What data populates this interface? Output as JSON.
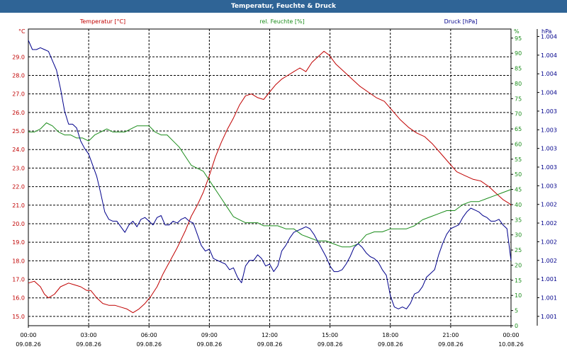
{
  "title": "Temperatur, Feuchte & Druck",
  "colors": {
    "temperature": "#c00000",
    "humidity": "#1a8c1a",
    "pressure": "#00008b",
    "titlebar": "#2f6496",
    "grid": "#000000"
  },
  "chart_data": {
    "type": "line",
    "title": "Temperatur, Feuchte & Druck",
    "x_tick_labels": [
      [
        "00:00",
        "09.08.26"
      ],
      [
        "03:00",
        "09.08.26"
      ],
      [
        "06:00",
        "09.08.26"
      ],
      [
        "09:00",
        "09.08.26"
      ],
      [
        "12:00",
        "09.08.26"
      ],
      [
        "15:00",
        "09.08.26"
      ],
      [
        "18:00",
        "09.08.26"
      ],
      [
        "21:00",
        "09.08.26"
      ],
      [
        "00:00",
        "10.08.26"
      ]
    ],
    "x_range_hours": [
      0,
      24
    ],
    "grid": true,
    "axes": {
      "temperature": {
        "label": "Temperatur [°C]",
        "unit": "°C",
        "side": "left",
        "ticks": [
          "15.0",
          "16.0",
          "17.0",
          "18.0",
          "19.0",
          "20.0",
          "21.0",
          "22.0",
          "23.0",
          "24.0",
          "25.0",
          "26.0",
          "27.0",
          "28.0",
          "29.0"
        ],
        "range": [
          14.5,
          30.5
        ]
      },
      "humidity": {
        "label": "rel. Feuchte [%]",
        "unit": "%",
        "side": "right",
        "ticks": [
          "0",
          "5",
          "10",
          "15",
          "20",
          "25",
          "30",
          "35",
          "40",
          "45",
          "50",
          "55",
          "60",
          "65",
          "70",
          "75",
          "80",
          "85",
          "90",
          "95"
        ],
        "range": [
          0,
          98
        ]
      },
      "pressure": {
        "label": "Druck [hPa]",
        "unit": "hPa",
        "side": "right",
        "ticks": [
          "1.001",
          "1.001",
          "1.001",
          "1.002",
          "1.002",
          "1.002",
          "1.002",
          "1.003",
          "1.003",
          "1.003",
          "1.003",
          "1.003",
          "1.004",
          "1.004",
          "1.004",
          "1.004"
        ],
        "range": [
          0,
          15.9
        ]
      }
    },
    "series": [
      {
        "name": "Temperatur [°C]",
        "axis": "temperature",
        "x": [
          0,
          0.3,
          0.6,
          0.8,
          1,
          1.3,
          1.6,
          2,
          2.3,
          2.6,
          2.9,
          3.1,
          3.4,
          3.7,
          4,
          4.3,
          4.6,
          4.9,
          5.2,
          5.5,
          5.8,
          6.1,
          6.4,
          6.7,
          7,
          7.4,
          7.8,
          8.1,
          8.4,
          8.7,
          9,
          9.3,
          9.6,
          9.9,
          10.2,
          10.5,
          10.8,
          11.1,
          11.4,
          11.7,
          12,
          12.3,
          12.6,
          12.9,
          13.2,
          13.5,
          13.8,
          14.1,
          14.4,
          14.7,
          14.95,
          15.3,
          15.7,
          16.1,
          16.5,
          16.9,
          17.3,
          17.7,
          18.1,
          18.5,
          18.9,
          19.3,
          19.7,
          20.1,
          20.5,
          20.9,
          21.3,
          21.7,
          22.1,
          22.5,
          22.9,
          23.3,
          23.6,
          23.9,
          24
        ],
        "y": [
          16.8,
          16.9,
          16.6,
          16.2,
          16.0,
          16.2,
          16.6,
          16.8,
          16.7,
          16.6,
          16.4,
          16.4,
          16.0,
          15.7,
          15.6,
          15.6,
          15.5,
          15.4,
          15.2,
          15.4,
          15.7,
          16.1,
          16.6,
          17.3,
          17.9,
          18.7,
          19.6,
          20.4,
          21.0,
          21.7,
          22.6,
          23.6,
          24.4,
          25.1,
          25.7,
          26.4,
          26.9,
          27.0,
          26.8,
          26.7,
          27.1,
          27.5,
          27.8,
          28.0,
          28.2,
          28.4,
          28.2,
          28.7,
          29.0,
          29.3,
          29.1,
          28.6,
          28.2,
          27.8,
          27.4,
          27.1,
          26.8,
          26.6,
          26.1,
          25.6,
          25.2,
          24.9,
          24.7,
          24.3,
          23.8,
          23.3,
          22.8,
          22.6,
          22.4,
          22.3,
          22.0,
          21.6,
          21.3,
          21.1,
          21.0
        ]
      },
      {
        "name": "rel. Feuchte [%]",
        "axis": "humidity",
        "x": [
          0,
          0.3,
          0.6,
          0.9,
          1.2,
          1.5,
          1.8,
          2.1,
          2.4,
          2.7,
          3,
          3.3,
          3.6,
          3.9,
          4.2,
          4.5,
          4.8,
          5.1,
          5.4,
          5.7,
          6,
          6.3,
          6.6,
          6.9,
          7.2,
          7.5,
          7.8,
          8.1,
          8.4,
          8.7,
          9,
          9.3,
          9.6,
          9.9,
          10.2,
          10.5,
          10.8,
          11.1,
          11.4,
          11.7,
          12,
          12.4,
          12.8,
          13.2,
          13.6,
          14,
          14.4,
          14.8,
          15.2,
          15.6,
          16,
          16.4,
          16.8,
          17.2,
          17.6,
          18,
          18.4,
          18.8,
          19.2,
          19.6,
          20,
          20.4,
          20.8,
          21.2,
          21.6,
          22,
          22.4,
          22.8,
          23.2,
          23.6,
          24
        ],
        "y": [
          64,
          64,
          65,
          67,
          66,
          64,
          63,
          63,
          62,
          62,
          61,
          63,
          64,
          65,
          64,
          64,
          64,
          65,
          66,
          66,
          66,
          64,
          63,
          63,
          61,
          59,
          56,
          53,
          52,
          51,
          48,
          45,
          42,
          39,
          36,
          35,
          34,
          34,
          34,
          33,
          33,
          33,
          32,
          32,
          30,
          29,
          28,
          28,
          27,
          26,
          26,
          27,
          30,
          31,
          31,
          32,
          32,
          32,
          33,
          35,
          36,
          37,
          38,
          38,
          40,
          41,
          41,
          42,
          43,
          44,
          45
        ]
      },
      {
        "name": "Druck [hPa]",
        "axis": "pressure",
        "x": [
          0,
          0.2,
          0.4,
          0.6,
          0.8,
          1,
          1.2,
          1.4,
          1.6,
          1.8,
          2,
          2.2,
          2.4,
          2.6,
          2.8,
          3,
          3.2,
          3.4,
          3.6,
          3.8,
          4,
          4.2,
          4.4,
          4.6,
          4.8,
          5,
          5.2,
          5.4,
          5.6,
          5.8,
          6,
          6.2,
          6.4,
          6.6,
          6.8,
          7,
          7.2,
          7.4,
          7.6,
          7.8,
          8,
          8.2,
          8.4,
          8.6,
          8.8,
          9,
          9.2,
          9.4,
          9.6,
          9.8,
          10,
          10.2,
          10.4,
          10.6,
          10.8,
          11,
          11.2,
          11.4,
          11.6,
          11.8,
          12,
          12.2,
          12.4,
          12.6,
          12.8,
          13,
          13.2,
          13.4,
          13.6,
          13.8,
          14,
          14.2,
          14.4,
          14.6,
          14.8,
          15,
          15.2,
          15.4,
          15.6,
          15.8,
          16,
          16.2,
          16.4,
          16.6,
          16.8,
          17,
          17.2,
          17.4,
          17.6,
          17.8,
          18,
          18.2,
          18.4,
          18.6,
          18.8,
          19,
          19.2,
          19.4,
          19.6,
          19.8,
          20,
          20.2,
          20.4,
          20.6,
          20.8,
          21,
          21.2,
          21.4,
          21.6,
          21.8,
          22,
          22.2,
          22.4,
          22.6,
          22.8,
          23,
          23.2,
          23.4,
          23.6,
          23.8,
          24
        ],
        "y": [
          15.3,
          14.8,
          14.8,
          14.9,
          14.8,
          14.7,
          14.2,
          13.7,
          12.7,
          11.5,
          10.8,
          10.8,
          10.6,
          9.9,
          9.5,
          9.2,
          8.6,
          8.0,
          7.1,
          6.1,
          5.7,
          5.6,
          5.6,
          5.3,
          5.0,
          5.4,
          5.6,
          5.3,
          5.7,
          5.8,
          5.6,
          5.4,
          5.8,
          5.9,
          5.4,
          5.4,
          5.6,
          5.5,
          5.7,
          5.8,
          5.6,
          5.5,
          4.9,
          4.3,
          4.0,
          4.1,
          3.6,
          3.5,
          3.4,
          3.3,
          3.0,
          3.1,
          2.6,
          2.3,
          3.2,
          3.5,
          3.5,
          3.8,
          3.6,
          3.2,
          3.3,
          2.9,
          3.2,
          4.0,
          4.3,
          4.7,
          5.0,
          5.1,
          5.2,
          5.3,
          5.2,
          4.9,
          4.5,
          4.1,
          3.7,
          3.2,
          2.9,
          2.9,
          3.0,
          3.3,
          3.7,
          4.2,
          4.4,
          4.2,
          3.9,
          3.7,
          3.6,
          3.4,
          3.0,
          2.7,
          1.6,
          1.0,
          0.9,
          1.0,
          0.9,
          1.2,
          1.7,
          1.8,
          2.1,
          2.6,
          2.8,
          3.0,
          3.8,
          4.4,
          4.9,
          5.2,
          5.3,
          5.4,
          5.8,
          6.1,
          6.3,
          6.2,
          6.1,
          5.9,
          5.8,
          5.6,
          5.6,
          5.7,
          5.4,
          5.2,
          3.5
        ]
      }
    ]
  }
}
